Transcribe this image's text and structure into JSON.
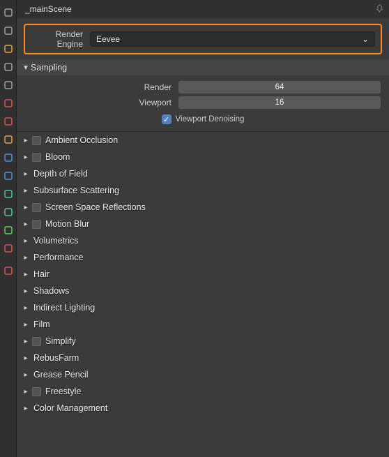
{
  "header": {
    "title": "_mainScene"
  },
  "engine": {
    "label": "Render Engine",
    "value": "Eevee"
  },
  "sampling": {
    "title": "Sampling",
    "render_label": "Render",
    "render_value": "64",
    "viewport_label": "Viewport",
    "viewport_value": "16",
    "denoise_label": "Viewport Denoising"
  },
  "panels": [
    {
      "label": "Ambient Occlusion",
      "checkbox": true
    },
    {
      "label": "Bloom",
      "checkbox": true
    },
    {
      "label": "Depth of Field",
      "checkbox": false
    },
    {
      "label": "Subsurface Scattering",
      "checkbox": false
    },
    {
      "label": "Screen Space Reflections",
      "checkbox": true
    },
    {
      "label": "Motion Blur",
      "checkbox": true
    },
    {
      "label": "Volumetrics",
      "checkbox": false
    },
    {
      "label": "Performance",
      "checkbox": false
    },
    {
      "label": "Hair",
      "checkbox": false
    },
    {
      "label": "Shadows",
      "checkbox": false
    },
    {
      "label": "Indirect Lighting",
      "checkbox": false
    },
    {
      "label": "Film",
      "checkbox": false
    },
    {
      "label": "Simplify",
      "checkbox": true
    },
    {
      "label": "RebusFarm",
      "checkbox": false
    },
    {
      "label": "Grease Pencil",
      "checkbox": false
    },
    {
      "label": "Freestyle",
      "checkbox": true
    },
    {
      "label": "Color Management",
      "checkbox": false
    }
  ],
  "toolbar_icons": [
    "display-icon",
    "tool-icon",
    "cube-icon",
    "layers-icon",
    "page-icon",
    "sphere-icon",
    "world-icon",
    "grid-icon",
    "wrench-icon",
    "effects-icon",
    "donut-icon",
    "overlay-icon",
    "green-icon",
    "red-icon",
    "divider",
    "material-icon"
  ],
  "toolbar_colors": {
    "display-icon": "#a0a0a0",
    "tool-icon": "#a0a0a0",
    "cube-icon": "#e0a050",
    "layers-icon": "#a0a0a0",
    "page-icon": "#a0a0a0",
    "sphere-icon": "#e05050",
    "world-icon": "#e05050",
    "grid-icon": "#e0a050",
    "wrench-icon": "#5090e0",
    "effects-icon": "#5090e0",
    "donut-icon": "#50c0a0",
    "overlay-icon": "#50c0a0",
    "green-icon": "#60d060",
    "red-icon": "#e05050",
    "material-icon": "#e05050"
  }
}
